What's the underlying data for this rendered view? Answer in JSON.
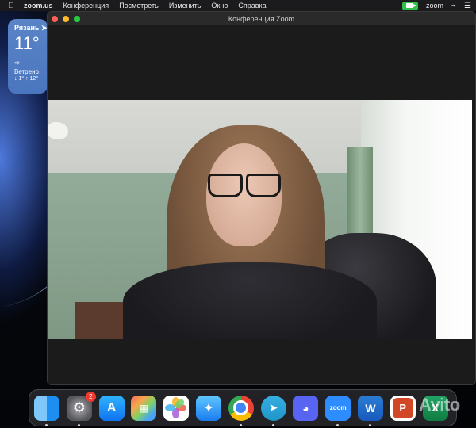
{
  "menubar": {
    "app_name": "zoom.us",
    "items": [
      "Конференция",
      "Посмотреть",
      "Изменить",
      "Окно",
      "Справка"
    ],
    "right": {
      "zoom_label": "zoom"
    }
  },
  "weather": {
    "city": "Рязань",
    "temperature": "11°",
    "condition": "Ветрено",
    "range": "↓ 1° ↑ 12°"
  },
  "zoom_window": {
    "title": "Конференция Zoom"
  },
  "dock": {
    "settings_badge": "2",
    "apps": [
      {
        "name": "Finder",
        "icon": "finder-icon",
        "running": true
      },
      {
        "name": "System Settings",
        "icon": "settings-icon",
        "running": true
      },
      {
        "name": "App Store",
        "icon": "app-store-icon",
        "running": false
      },
      {
        "name": "Launchpad",
        "icon": "launchpad-icon",
        "running": false
      },
      {
        "name": "Photos",
        "icon": "photos-icon",
        "running": false
      },
      {
        "name": "Safari",
        "icon": "safari-icon",
        "running": false
      },
      {
        "name": "Chrome",
        "icon": "chrome-icon",
        "running": true
      },
      {
        "name": "Telegram",
        "icon": "telegram-icon",
        "running": true
      },
      {
        "name": "Discord",
        "icon": "discord-icon",
        "running": false
      },
      {
        "name": "Zoom",
        "icon": "zoom-icon",
        "running": true
      },
      {
        "name": "Word",
        "icon": "word-icon",
        "running": true
      },
      {
        "name": "PowerPoint",
        "icon": "powerpoint-icon",
        "running": false
      },
      {
        "name": "Excel",
        "icon": "excel-icon",
        "running": false
      }
    ],
    "zoom_label": "zoom",
    "word_letter": "W",
    "powerpoint_letter": "P",
    "excel_letter": "X"
  },
  "watermark": "Avito",
  "colors": {
    "menubar_bg": "#1b1b1d",
    "camera_indicator": "#33c04a",
    "badge": "#f03a2f"
  }
}
